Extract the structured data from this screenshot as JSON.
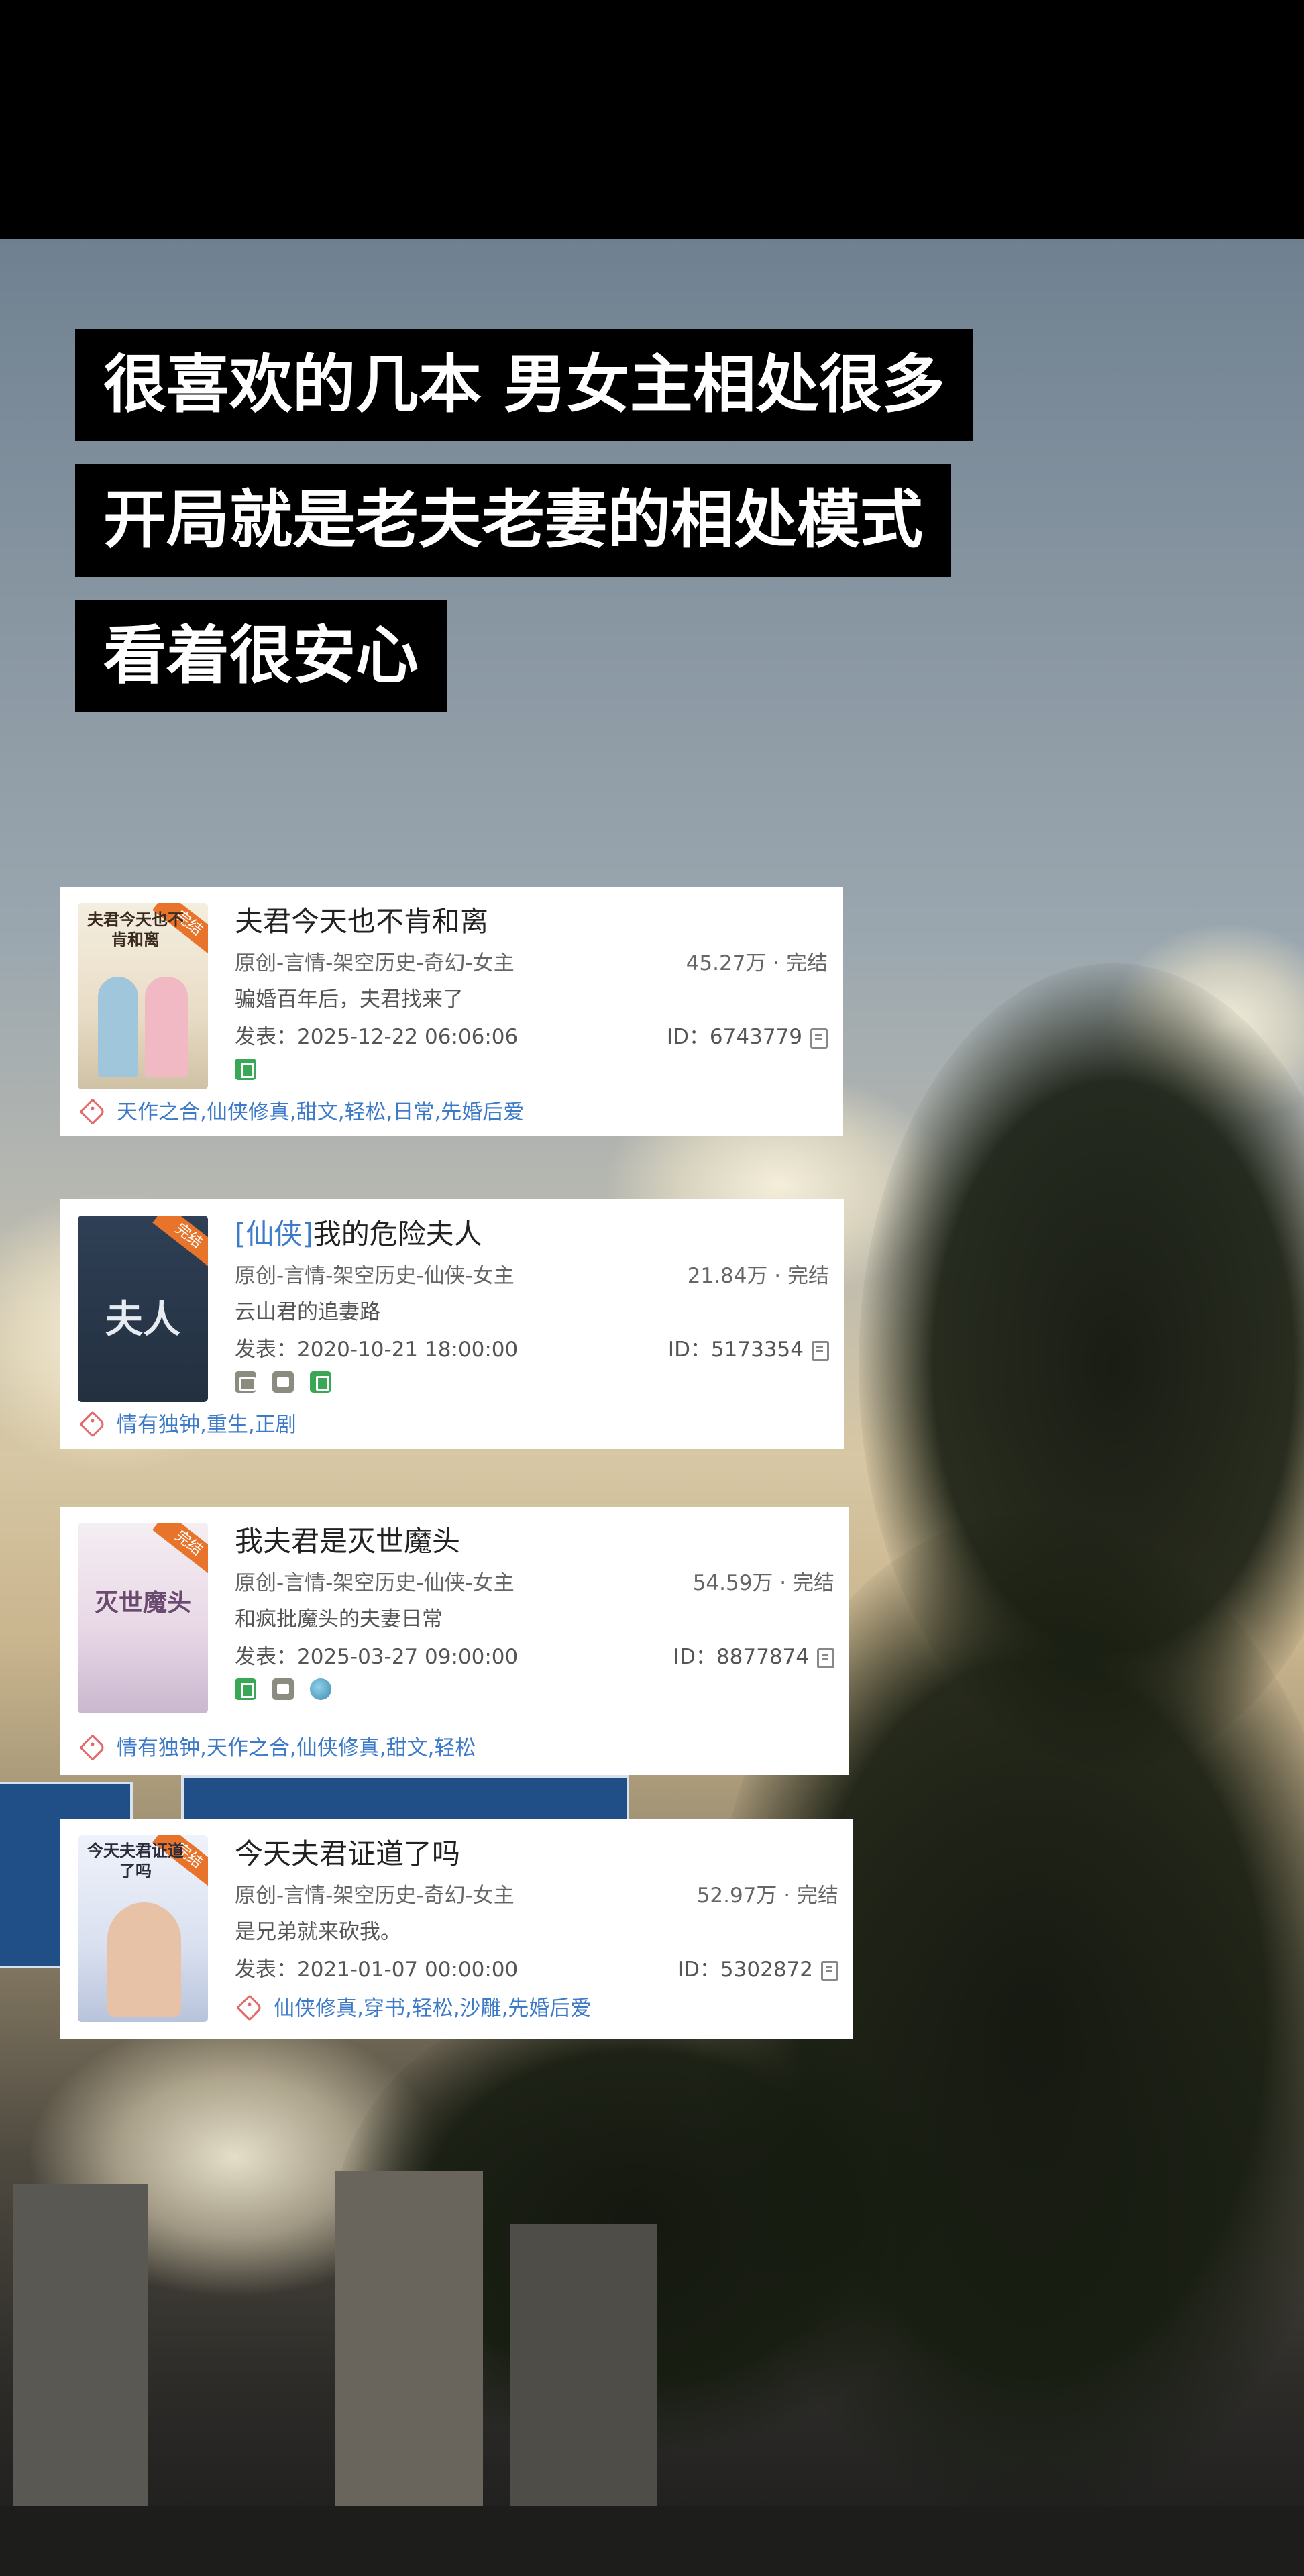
{
  "headlines": [
    "很喜欢的几本 男女主相处很多",
    "开局就是老夫老妻的相处模式",
    "看着很安心"
  ],
  "books": [
    {
      "title_tag": "",
      "title": "夫君今天也不肯和离",
      "genre": "原创-言情-架空历史-奇幻-女主",
      "stat": "45.27万 · 完结",
      "desc": "骗婚百年后，夫君找来了",
      "pub": "发表：2025-12-22 06:06:06",
      "id": "ID：6743779",
      "cover_badge": "完结",
      "cover_text": "夫君今天也不肯和离",
      "icons": [
        "book-icon"
      ],
      "tags": "天作之合,仙侠修真,甜文,轻松,日常,先婚后爱"
    },
    {
      "title_tag": "[仙侠]",
      "title": "我的危险夫人",
      "genre": "原创-言情-架空历史-仙侠-女主",
      "stat": "21.84万 · 完结",
      "desc": "云山君的追妻路",
      "pub": "发表：2020-10-21 18:00:00",
      "id": "ID：5173354",
      "cover_badge": "完结",
      "cover_text": "夫人",
      "icons": [
        "audio-icon",
        "video-icon",
        "book-icon"
      ],
      "tags": "情有独钟,重生,正剧"
    },
    {
      "title_tag": "",
      "title": "我夫君是灭世魔头",
      "genre": "原创-言情-架空历史-仙侠-女主",
      "stat": "54.59万 · 完结",
      "desc": "和疯批魔头的夫妻日常",
      "pub": "发表：2025-03-27 09:00:00",
      "id": "ID：8877874",
      "cover_badge": "完结",
      "cover_text": "灭世魔头",
      "icons": [
        "book-icon",
        "video-icon",
        "globe-icon"
      ],
      "tags": "情有独钟,天作之合,仙侠修真,甜文,轻松"
    },
    {
      "title_tag": "",
      "title": "今天夫君证道了吗",
      "genre": "原创-言情-架空历史-奇幻-女主",
      "stat": "52.97万 · 完结",
      "desc": "是兄弟就来砍我。",
      "pub": "发表：2021-01-07 00:00:00",
      "id": "ID：5302872",
      "cover_badge": "完结",
      "cover_text": "今天夫君证道了吗",
      "icons": [],
      "tags": "仙侠修真,穿书,轻松,沙雕,先婚后爱"
    }
  ]
}
